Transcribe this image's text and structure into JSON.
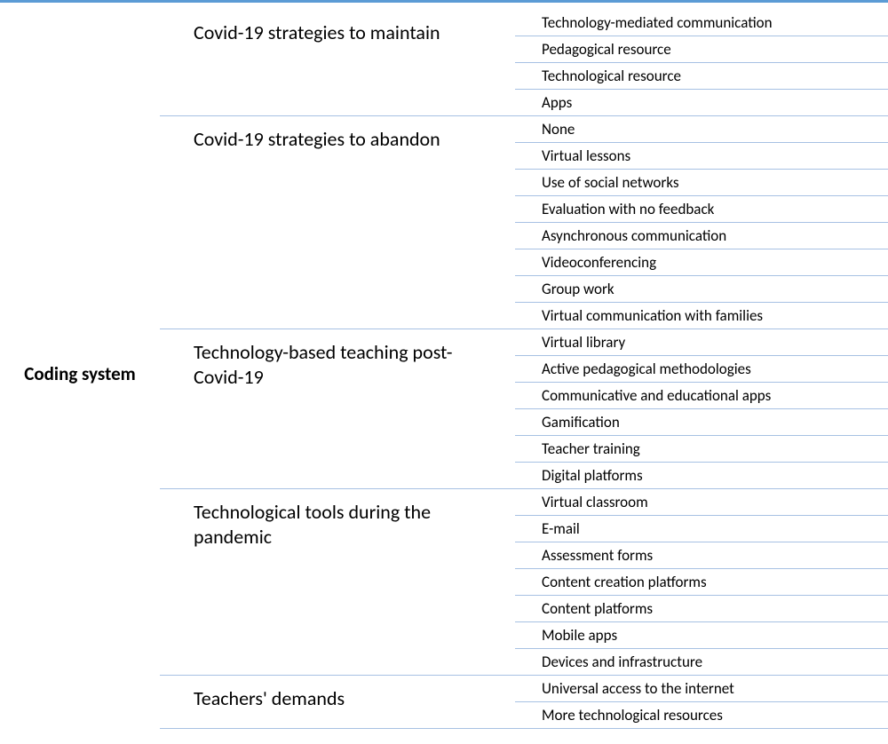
{
  "root_label": "Coding system",
  "categories": [
    {
      "label": "Covid-19 strategies to maintain",
      "items": [
        "Technology-mediated communication",
        "Pedagogical resource",
        "Technological resource",
        "Apps"
      ]
    },
    {
      "label": "Covid-19 strategies to abandon",
      "items": [
        "None",
        "Virtual lessons",
        "Use of social networks",
        "Evaluation with no feedback",
        "Asynchronous communication",
        "Videoconferencing",
        "Group work",
        "Virtual communication with families"
      ]
    },
    {
      "label": "Technology-based teaching post-Covid-19",
      "items": [
        "Virtual library",
        "Active pedagogical methodologies",
        "Communicative and educational apps",
        "Gamification",
        "Teacher training",
        "Digital platforms"
      ]
    },
    {
      "label": "Technological tools during the pandemic",
      "items": [
        "Virtual classroom",
        "E-mail",
        "Assessment forms",
        "Content creation platforms",
        "Content platforms",
        "Mobile apps",
        "Devices and infrastructure"
      ]
    },
    {
      "label": "Teachers' demands",
      "items": [
        "Universal access to the internet",
        "More technological resources"
      ]
    }
  ]
}
